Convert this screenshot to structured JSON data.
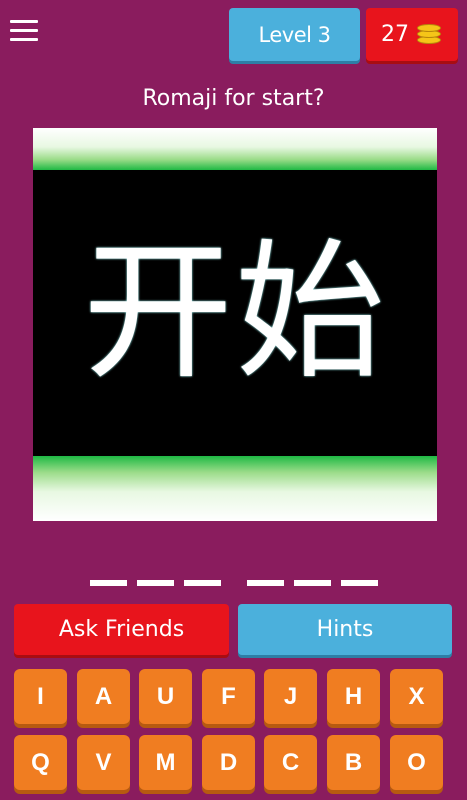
{
  "header": {
    "menu_icon": "hamburger-menu-icon",
    "level_label": "Level 3",
    "coins": "27",
    "coin_icon": "coin-stack-icon"
  },
  "question": "Romaji for start?",
  "picture": {
    "text": "开始"
  },
  "answer": {
    "word_lengths": [
      3,
      3
    ]
  },
  "buttons": {
    "ask_friends": "Ask Friends",
    "hints": "Hints"
  },
  "keyboard": {
    "row1": [
      "I",
      "A",
      "U",
      "F",
      "J",
      "H",
      "X"
    ],
    "row2": [
      "Q",
      "V",
      "M",
      "D",
      "C",
      "B",
      "O"
    ]
  },
  "colors": {
    "background": "#8a1c5e",
    "red": "#e8141c",
    "blue": "#4bb0dc",
    "orange": "#f07d21",
    "green": "#1fb944"
  }
}
